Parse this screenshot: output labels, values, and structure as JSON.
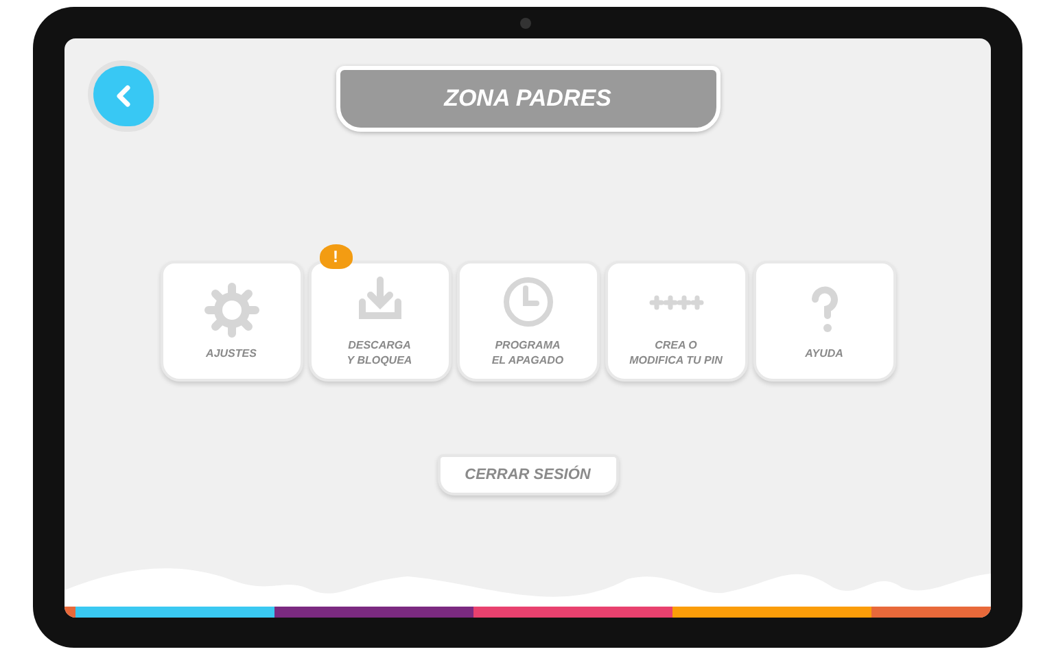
{
  "header": {
    "back_button": {
      "kind": "back"
    },
    "title": "ZONA PADRES"
  },
  "tiles": [
    {
      "kind": "gear",
      "label": "AJUSTES",
      "alert": false
    },
    {
      "kind": "download",
      "label": "DESCARGA\nY BLOQUEA",
      "alert": true,
      "badge": "!"
    },
    {
      "kind": "clock",
      "label": "PROGRAMA\nEL APAGADO",
      "alert": false
    },
    {
      "kind": "pin",
      "label": "CREA O\nMODIFICA TU PIN",
      "alert": false
    },
    {
      "kind": "help",
      "label": "AYUDA",
      "alert": false
    }
  ],
  "logout_button": "CERRAR SESIÓN"
}
